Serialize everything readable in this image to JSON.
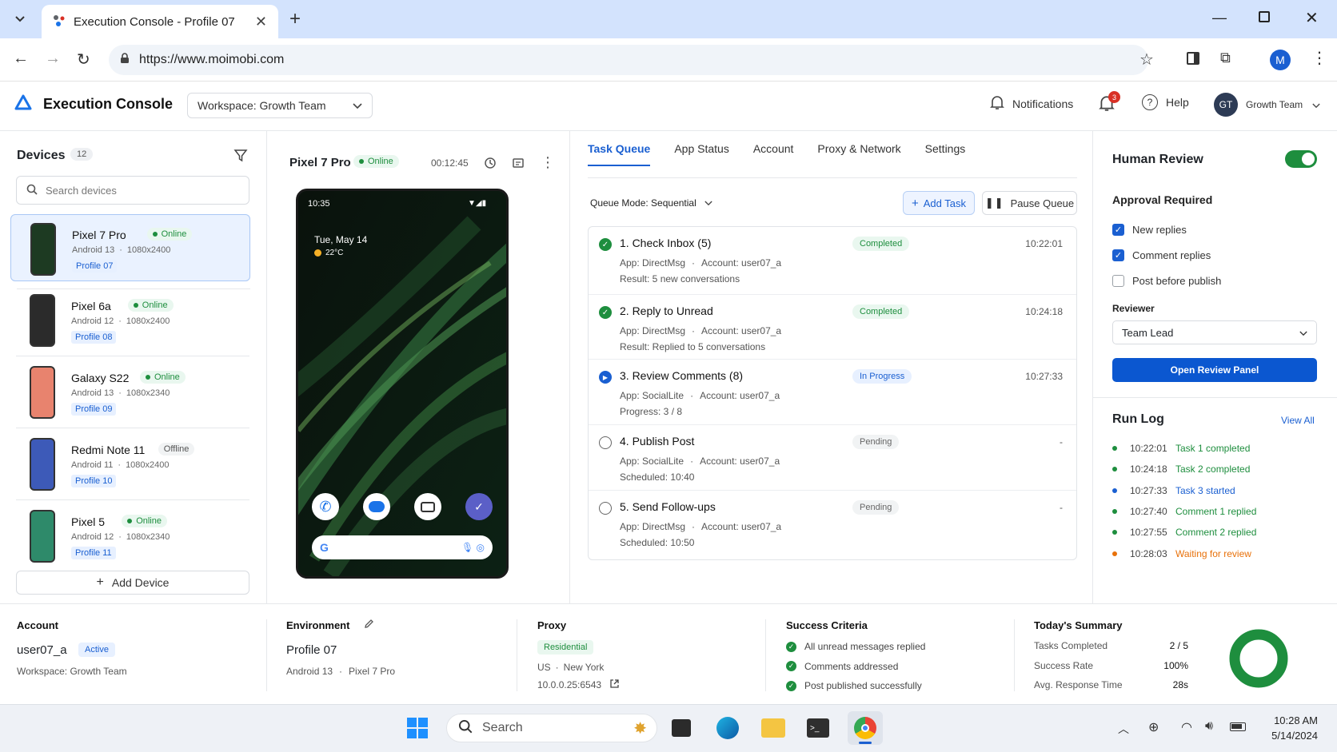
{
  "browser": {
    "tab_title": "Execution Console - Profile 07",
    "url": "https://www.moimobi.com",
    "profile_initial": "M"
  },
  "app": {
    "title": "Execution Console",
    "workspace": "Workspace: Growth Team",
    "notifications_label": "Notifications",
    "notification_count": "3",
    "help_label": "Help",
    "user_initials": "GT",
    "user_name": "Growth Team"
  },
  "devices": {
    "title": "Devices",
    "count": "12",
    "search_placeholder": "Search devices",
    "add_label": "Add Device",
    "items": [
      {
        "name": "Pixel 7 Pro",
        "status": "Online",
        "os": "Android 13",
        "res": "1080x2400",
        "profile": "Profile 07",
        "color": "#1d3a22"
      },
      {
        "name": "Pixel 6a",
        "status": "Online",
        "os": "Android 12",
        "res": "1080x2400",
        "profile": "Profile 08",
        "color": "#2b2b2b"
      },
      {
        "name": "Galaxy S22",
        "status": "Online",
        "os": "Android 13",
        "res": "1080x2340",
        "profile": "Profile 09",
        "color": "#e8836e"
      },
      {
        "name": "Redmi Note 11",
        "status": "Offline",
        "os": "Android 11",
        "res": "1080x2400",
        "profile": "Profile 10",
        "color": "#3d5ab8"
      },
      {
        "name": "Pixel 5",
        "status": "Online",
        "os": "Android 12",
        "res": "1080x2340",
        "profile": "Profile 11",
        "color": "#2e8a6a"
      }
    ]
  },
  "preview": {
    "device": "Pixel 7 Pro",
    "status": "Online",
    "timer": "00:12:45",
    "phone_time": "10:35",
    "phone_date": "Tue, May 14",
    "phone_temp": "22°C"
  },
  "tabs": [
    "Task Queue",
    "App Status",
    "Account",
    "Proxy & Network",
    "Settings"
  ],
  "queue": {
    "mode": "Queue Mode: Sequential",
    "add_task": "Add Task",
    "pause": "Pause Queue",
    "tasks": [
      {
        "title": "1. Check Inbox (5)",
        "status": "Completed",
        "time": "10:22:01",
        "app": "App: DirectMsg",
        "account": "Account: user07_a",
        "detail": "Result: 5 new conversations"
      },
      {
        "title": "2. Reply to Unread",
        "status": "Completed",
        "time": "10:24:18",
        "app": "App: DirectMsg",
        "account": "Account: user07_a",
        "detail": "Result: Replied to 5 conversations"
      },
      {
        "title": "3. Review Comments (8)",
        "status": "In Progress",
        "time": "10:27:33",
        "app": "App: SocialLite",
        "account": "Account: user07_a",
        "detail": "Progress: 3 / 8"
      },
      {
        "title": "4. Publish Post",
        "status": "Pending",
        "time": "-",
        "app": "App: SocialLite",
        "account": "Account: user07_a",
        "detail": "Scheduled: 10:40"
      },
      {
        "title": "5. Send Follow-ups",
        "status": "Pending",
        "time": "-",
        "app": "App: DirectMsg",
        "account": "Account: user07_a",
        "detail": "Scheduled: 10:50"
      }
    ]
  },
  "review": {
    "title": "Human Review",
    "approval_title": "Approval Required",
    "options": [
      {
        "label": "New replies",
        "checked": true
      },
      {
        "label": "Comment replies",
        "checked": true
      },
      {
        "label": "Post before publish",
        "checked": false
      }
    ],
    "reviewer_label": "Reviewer",
    "reviewer_value": "Team Lead",
    "open_button": "Open Review Panel"
  },
  "runlog": {
    "title": "Run Log",
    "view_all": "View All",
    "entries": [
      {
        "time": "10:22:01",
        "text": "Task 1 completed",
        "color": "#1e8e3e"
      },
      {
        "time": "10:24:18",
        "text": "Task 2 completed",
        "color": "#1e8e3e"
      },
      {
        "time": "10:27:33",
        "text": "Task 3 started",
        "color": "#1a5fd1"
      },
      {
        "time": "10:27:40",
        "text": "Comment 1 replied",
        "color": "#1e8e3e"
      },
      {
        "time": "10:27:55",
        "text": "Comment 2 replied",
        "color": "#1e8e3e"
      },
      {
        "time": "10:28:03",
        "text": "Waiting for review",
        "color": "#e8710a"
      }
    ]
  },
  "bottom": {
    "account": {
      "title": "Account",
      "user": "user07_a",
      "status": "Active",
      "workspace": "Workspace:  Growth Team"
    },
    "environment": {
      "title": "Environment",
      "profile": "Profile 07",
      "os": "Android 13",
      "device": "Pixel 7 Pro"
    },
    "proxy": {
      "title": "Proxy",
      "type": "Residential",
      "country": "US",
      "city": "New York",
      "ip": "10.0.0.25:6543"
    },
    "criteria": {
      "title": "Success Criteria",
      "items": [
        "All unread messages replied",
        "Comments addressed",
        "Post published successfully"
      ]
    },
    "summary": {
      "title": "Today's Summary",
      "rows": [
        {
          "label": "Tasks Completed",
          "value": "2 / 5"
        },
        {
          "label": "Success Rate",
          "value": "100%"
        },
        {
          "label": "Avg. Response Time",
          "value": "28s"
        }
      ],
      "success_fraction": 1.0
    }
  },
  "taskbar": {
    "search": "Search",
    "time": "10:28 AM",
    "date": "5/14/2024"
  },
  "colors": {
    "accent": "#1a5fd1",
    "success": "#1e8e3e",
    "warning": "#e8710a"
  }
}
